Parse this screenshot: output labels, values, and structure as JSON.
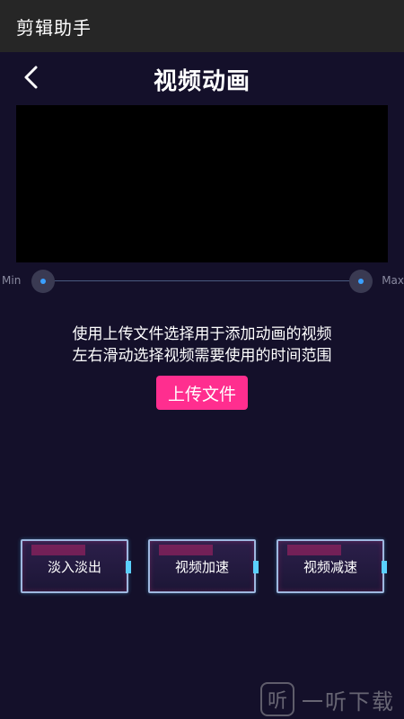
{
  "appbar": {
    "title": "剪辑助手"
  },
  "header": {
    "title": "视频动画",
    "back_icon": "chevron-left-icon"
  },
  "preview": {
    "background": "#000000"
  },
  "slider": {
    "min_label": "Min",
    "max_label": "Max",
    "accent": "#3aa0ff"
  },
  "instructions": {
    "line1": "使用上传文件选择用于添加动画的视频",
    "line2": "左右滑动选择视频需要使用的时间范围"
  },
  "upload": {
    "label": "上传文件",
    "color": "#ff2e8f"
  },
  "actions": [
    {
      "label": "淡入淡出"
    },
    {
      "label": "视频加速"
    },
    {
      "label": "视频减速"
    }
  ],
  "watermark": {
    "logo": "听",
    "text": "一听下载"
  },
  "colors": {
    "background": "#14102a",
    "appbar": "#262626"
  }
}
